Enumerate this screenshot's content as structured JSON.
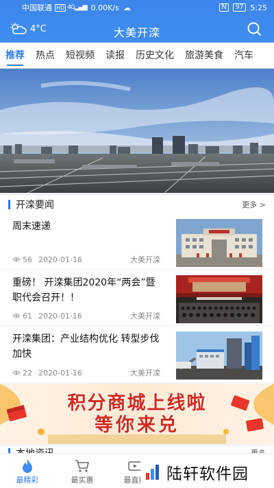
{
  "status_bar": {
    "carrier": "中国联通",
    "hd": "HD",
    "network": "4G",
    "speed": "0.00K/s",
    "nfc": "N",
    "battery": "97",
    "time": "5:25"
  },
  "header": {
    "temperature": "4°C",
    "title": "大美开滦"
  },
  "tabs": [
    "推荐",
    "热点",
    "短视频",
    "读报",
    "历史文化",
    "旅游美食",
    "汽车"
  ],
  "news_section": {
    "title": "开滦要闻",
    "more": "更多 >",
    "items": [
      {
        "title": "周末速递",
        "views": "56",
        "date": "2020-01-16",
        "source": "大美开滦"
      },
      {
        "title": "重磅！ 开滦集团2020年“两会”暨职代会召开！！",
        "views": "61",
        "date": "2020-01-16",
        "source": "大美开滦"
      },
      {
        "title": "开滦集团：产业结构优化 转型步伐加快",
        "views": "22",
        "date": "2020-01-16",
        "source": "大美开滦"
      }
    ]
  },
  "banner": {
    "line1": "积分商城上线啦",
    "line2": "等你来兑"
  },
  "local_section": {
    "title": "本地资讯",
    "more": "更多"
  },
  "bottom_nav": [
    {
      "label": "最精彩",
      "icon": "flame-icon"
    },
    {
      "label": "最实惠",
      "icon": "cart-icon"
    },
    {
      "label": "最直播",
      "icon": "tv-icon"
    }
  ],
  "watermark": "陆轩软件园",
  "colors": {
    "primary": "#3f8df0",
    "accent": "#2d7be5",
    "banner_red": "#e8372a",
    "banner_orange": "#f7b43b"
  }
}
